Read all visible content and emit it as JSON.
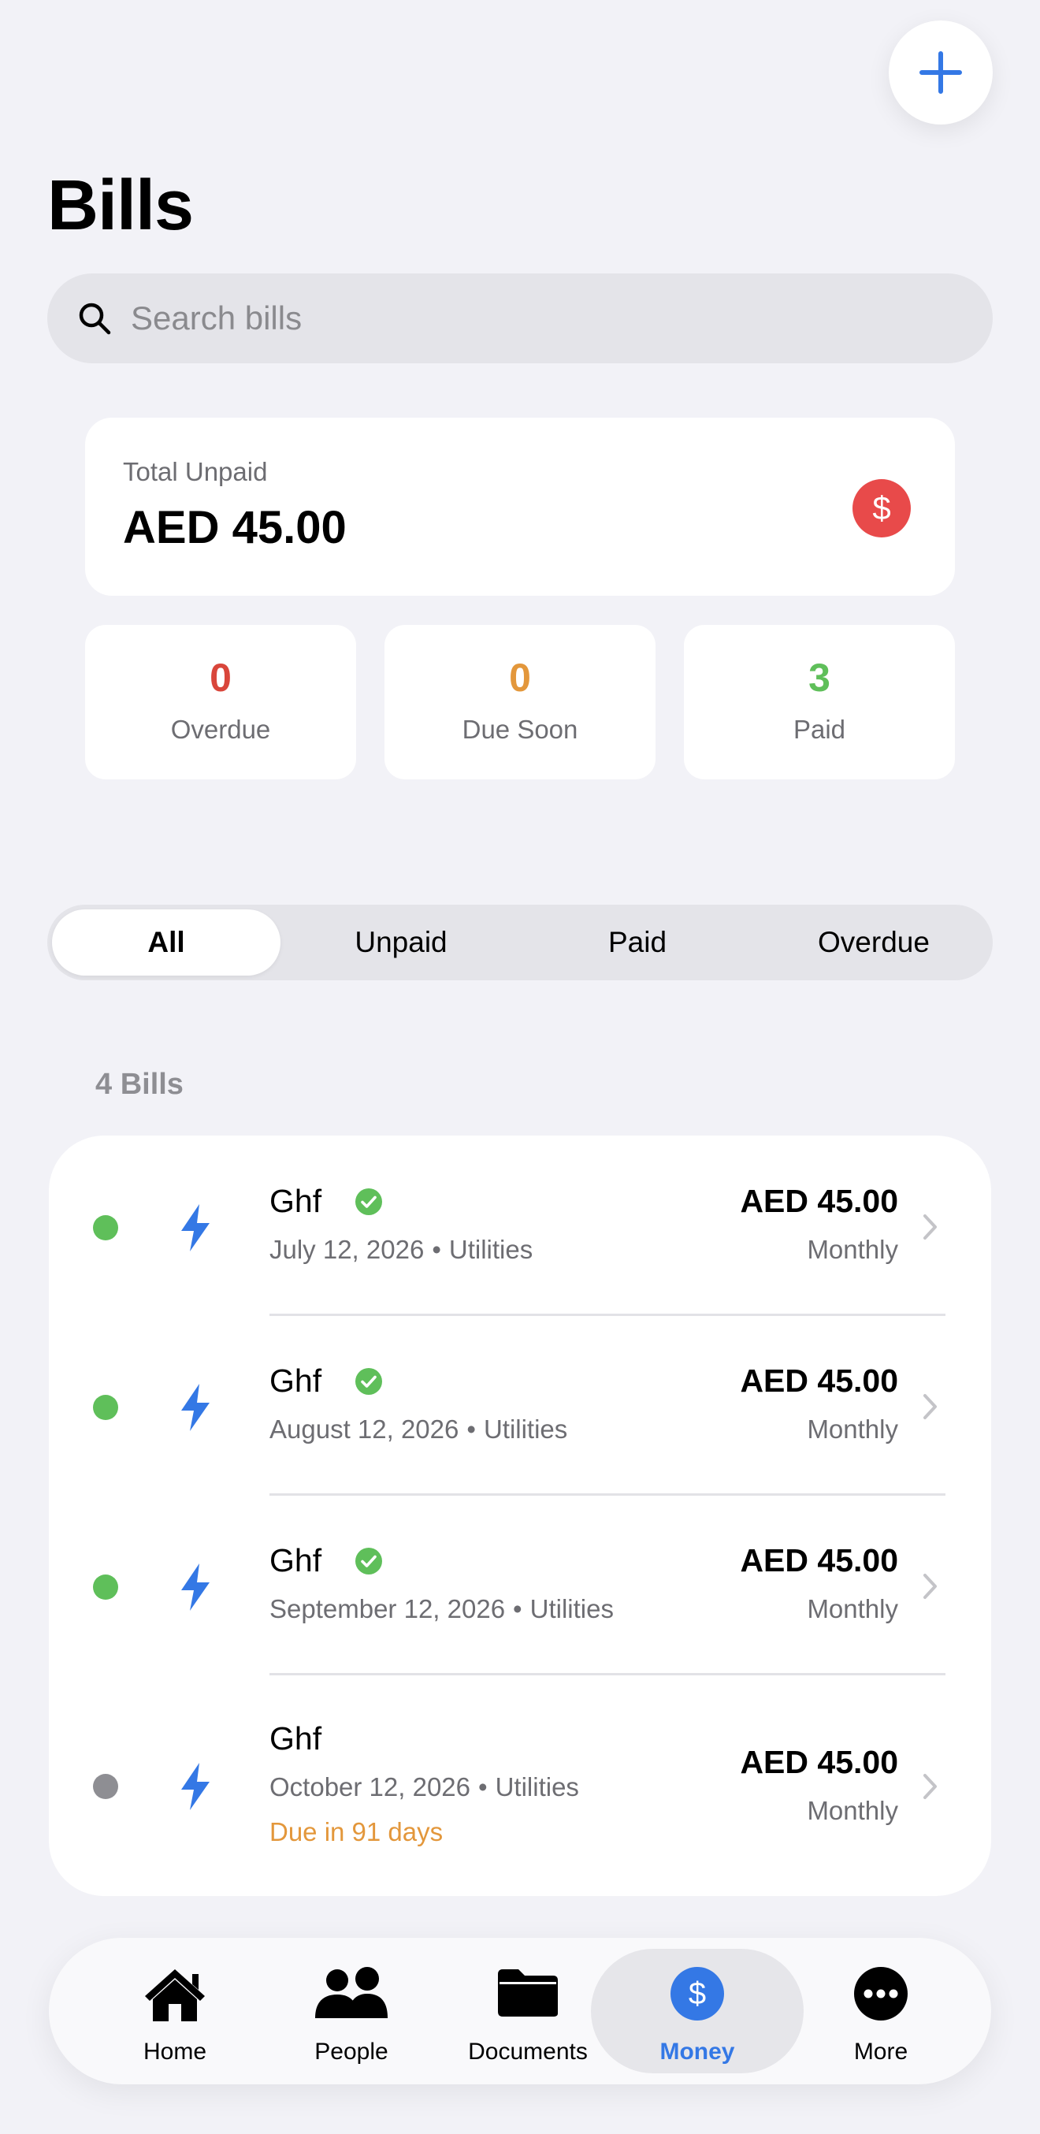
{
  "header": {
    "title": "Bills",
    "add_icon": "plus-icon"
  },
  "search": {
    "placeholder": "Search bills",
    "value": ""
  },
  "summary": {
    "label": "Total Unpaid",
    "amount": "AED 45.00",
    "icon": "dollar-icon",
    "badge_symbol": "$",
    "badge_color": "#e84a4a"
  },
  "stats": [
    {
      "value": "0",
      "label": "Overdue",
      "color": "#d9463b"
    },
    {
      "value": "0",
      "label": "Due Soon",
      "color": "#e3973b"
    },
    {
      "value": "3",
      "label": "Paid",
      "color": "#5fbf5a"
    }
  ],
  "filters": {
    "options": [
      "All",
      "Unpaid",
      "Paid",
      "Overdue"
    ],
    "selected": "All"
  },
  "list": {
    "count_label": "4 Bills",
    "bills": [
      {
        "name": "Ghf",
        "date": "July 12, 2026",
        "separator": "•",
        "category": "Utilities",
        "amount": "AED 45.00",
        "frequency": "Monthly",
        "status": "paid",
        "dot_color": "#5fbf5a",
        "icon": "lightning-bolt-icon"
      },
      {
        "name": "Ghf",
        "date": "August 12, 2026",
        "separator": "•",
        "category": "Utilities",
        "amount": "AED 45.00",
        "frequency": "Monthly",
        "status": "paid",
        "dot_color": "#5fbf5a",
        "icon": "lightning-bolt-icon"
      },
      {
        "name": "Ghf",
        "date": "September 12, 2026",
        "separator": "•",
        "category": "Utilities",
        "amount": "AED 45.00",
        "frequency": "Monthly",
        "status": "paid",
        "dot_color": "#5fbf5a",
        "icon": "lightning-bolt-icon"
      },
      {
        "name": "Ghf",
        "date": "October 12, 2026",
        "separator": "•",
        "category": "Utilities",
        "amount": "AED 45.00",
        "frequency": "Monthly",
        "status": "unpaid",
        "due_text": "Due in 91 days",
        "dot_color": "#8e8e93",
        "icon": "lightning-bolt-icon"
      }
    ]
  },
  "tabbar": {
    "tabs": [
      {
        "label": "Home",
        "icon": "house-icon"
      },
      {
        "label": "People",
        "icon": "people-icon"
      },
      {
        "label": "Documents",
        "icon": "folder-icon"
      },
      {
        "label": "Money",
        "icon": "dollar-circle-icon"
      },
      {
        "label": "More",
        "icon": "ellipsis-circle-icon"
      }
    ],
    "selected": "Money"
  },
  "colors": {
    "accent": "#3478e5",
    "background": "#f2f2f7",
    "due_soon": "#e3973b"
  }
}
